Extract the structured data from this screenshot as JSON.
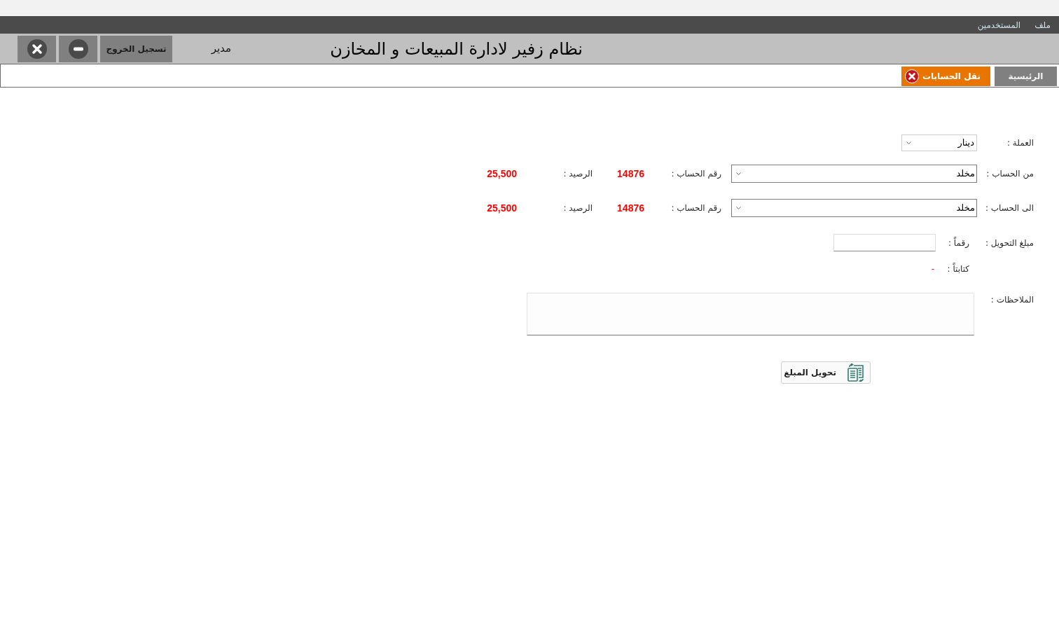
{
  "menu_bar": {
    "items": [
      "ملف",
      "المستخدمين"
    ]
  },
  "header": {
    "title": "نظام زفير لادارة المبيعات و المخازن",
    "user_role": "مدير",
    "buttons": [
      {
        "kind": "logout",
        "label": "تسجيل الخروج"
      },
      {
        "kind": "minimize"
      },
      {
        "kind": "close"
      }
    ]
  },
  "tabs": [
    {
      "label": "الرئيسية",
      "selected": false,
      "closable": false
    },
    {
      "label": "نقل الحسابات",
      "selected": true,
      "closable": true
    }
  ],
  "form": {
    "currency": {
      "label": "العملة :",
      "value": "دينار"
    },
    "accounts": [
      {
        "label": "من الحساب :",
        "value": "مخلد",
        "account_number_label": "رقم الحساب :",
        "account_number": "14876",
        "balance_label": "الرصيد :",
        "balance": "25,500"
      },
      {
        "label": "الى الحساب :",
        "value": "مخلد",
        "account_number_label": "رقم الحساب :",
        "account_number": "14876",
        "balance_label": "الرصيد :",
        "balance": "25,500"
      }
    ],
    "transfer_amount": {
      "label": "مبلغ التحويل :",
      "numeric_label": "رقماً :",
      "words_label": "كتابتاً :",
      "words_value": "-"
    },
    "notes": {
      "label": "الملاحظات :"
    },
    "submit_button": {
      "label": "تحويل المبلغ"
    }
  }
}
